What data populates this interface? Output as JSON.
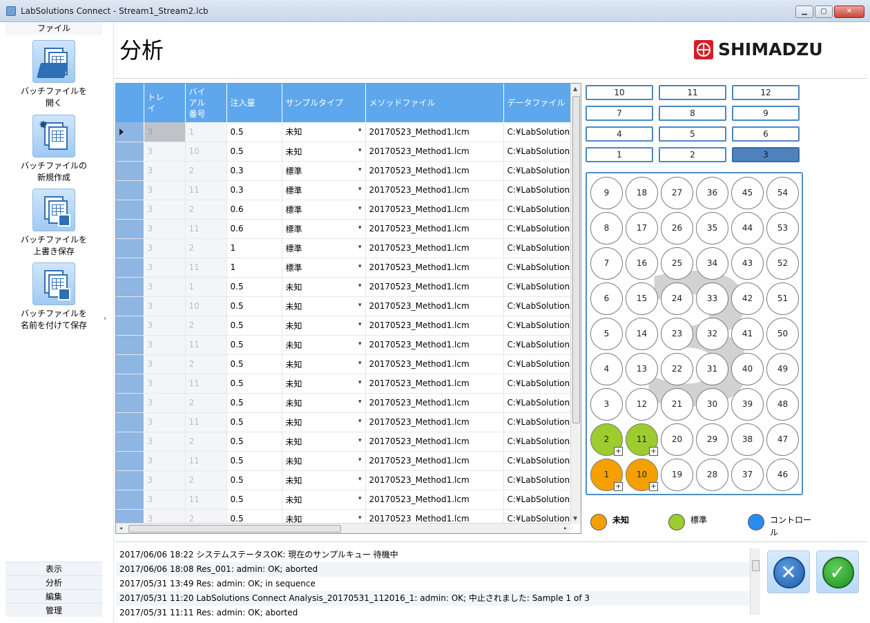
{
  "window": {
    "title": "LabSolutions Connect - Stream1_Stream2.lcb",
    "min_label": "▁",
    "max_label": "▢",
    "close_label": "✕"
  },
  "sidebar": {
    "header": "ファイル",
    "items": [
      {
        "label": "バッチファイルを\n開く",
        "icon": "open-batch-file-icon"
      },
      {
        "label": "バッチファイルの\n新規作成",
        "icon": "new-batch-file-icon"
      },
      {
        "label": "バッチファイルを\n上書き保存",
        "icon": "save-batch-file-icon"
      },
      {
        "label": "バッチファイルを\n名前を付けて保存",
        "icon": "save-as-batch-file-icon"
      }
    ],
    "collapse_glyph": "‹",
    "nav": [
      "表示",
      "分析",
      "編集",
      "管理"
    ]
  },
  "header": {
    "title": "分析",
    "logo_text": "SHIMADZU"
  },
  "table": {
    "columns": [
      "",
      "トレ\nイ",
      "バイ\nアル\n番号",
      "注入量",
      "サンプルタイプ",
      "メソッドファイル",
      "データファイル"
    ],
    "rows": [
      [
        "3",
        "1",
        "0.5",
        "未知",
        "20170523_Method1.lcm",
        "C:¥LabSolutions"
      ],
      [
        "3",
        "10",
        "0.5",
        "未知",
        "20170523_Method1.lcm",
        "C:¥LabSolutions"
      ],
      [
        "3",
        "2",
        "0.3",
        "標準",
        "20170523_Method1.lcm",
        "C:¥LabSolutions"
      ],
      [
        "3",
        "11",
        "0.3",
        "標準",
        "20170523_Method1.lcm",
        "C:¥LabSolutions"
      ],
      [
        "3",
        "2",
        "0.6",
        "標準",
        "20170523_Method1.lcm",
        "C:¥LabSolutions"
      ],
      [
        "3",
        "11",
        "0.6",
        "標準",
        "20170523_Method1.lcm",
        "C:¥LabSolutions"
      ],
      [
        "3",
        "2",
        "1",
        "標準",
        "20170523_Method1.lcm",
        "C:¥LabSolutions"
      ],
      [
        "3",
        "11",
        "1",
        "標準",
        "20170523_Method1.lcm",
        "C:¥LabSolutions"
      ],
      [
        "3",
        "1",
        "0.5",
        "未知",
        "20170523_Method1.lcm",
        "C:¥LabSolutions"
      ],
      [
        "3",
        "10",
        "0.5",
        "未知",
        "20170523_Method1.lcm",
        "C:¥LabSolutions"
      ],
      [
        "3",
        "2",
        "0.5",
        "未知",
        "20170523_Method1.lcm",
        "C:¥LabSolutions"
      ],
      [
        "3",
        "11",
        "0.5",
        "未知",
        "20170523_Method1.lcm",
        "C:¥LabSolutions"
      ],
      [
        "3",
        "2",
        "0.5",
        "未知",
        "20170523_Method1.lcm",
        "C:¥LabSolutions"
      ],
      [
        "3",
        "11",
        "0.5",
        "未知",
        "20170523_Method1.lcm",
        "C:¥LabSolutions"
      ],
      [
        "3",
        "2",
        "0.5",
        "未知",
        "20170523_Method1.lcm",
        "C:¥LabSolutions"
      ],
      [
        "3",
        "11",
        "0.5",
        "未知",
        "20170523_Method1.lcm",
        "C:¥LabSolutions"
      ],
      [
        "3",
        "2",
        "0.5",
        "未知",
        "20170523_Method1.lcm",
        "C:¥LabSolutions"
      ],
      [
        "3",
        "11",
        "0.5",
        "未知",
        "20170523_Method1.lcm",
        "C:¥LabSolutions"
      ],
      [
        "3",
        "2",
        "0.5",
        "未知",
        "20170523_Method1.lcm",
        "C:¥LabSolutions"
      ],
      [
        "3",
        "11",
        "0.5",
        "未知",
        "20170523_Method1.lcm",
        "C:¥LabSolutions"
      ],
      [
        "3",
        "2",
        "0.5",
        "未知",
        "20170523_Method1.lcm",
        "C:¥LabSolutions"
      ]
    ],
    "dropdown_glyph": "▾",
    "scroll_glyphs": {
      "up": "▲",
      "down": "▼",
      "left": "◂",
      "right": "▸",
      "grip": "Ⅲ"
    }
  },
  "trays": {
    "buttons": [
      [
        "10",
        "11",
        "12"
      ],
      [
        "7",
        "8",
        "9"
      ],
      [
        "4",
        "5",
        "6"
      ],
      [
        "1",
        "2",
        "3"
      ]
    ],
    "selected": "3"
  },
  "vials": {
    "watermark": "3",
    "columns": [
      [
        "9",
        "8",
        "7",
        "6",
        "5",
        "4",
        "3",
        "2",
        "1"
      ],
      [
        "18",
        "17",
        "16",
        "15",
        "14",
        "13",
        "12",
        "11",
        "10"
      ],
      [
        "27",
        "26",
        "25",
        "24",
        "23",
        "22",
        "21",
        "20",
        "19"
      ],
      [
        "36",
        "35",
        "34",
        "33",
        "32",
        "31",
        "30",
        "29",
        "28"
      ],
      [
        "45",
        "44",
        "43",
        "42",
        "41",
        "40",
        "39",
        "38",
        "37"
      ],
      [
        "54",
        "53",
        "52",
        "51",
        "50",
        "49",
        "48",
        "47",
        "46"
      ]
    ],
    "unknown": [
      "1",
      "10"
    ],
    "standard": [
      "2",
      "11"
    ],
    "plus_glyph": "+"
  },
  "legend": [
    {
      "label": "未知",
      "color": "#f5a000"
    },
    {
      "label": "標準",
      "color": "#9ccc2e"
    },
    {
      "label": "コントロー\nル",
      "color": "#2a8cf0"
    }
  ],
  "log": [
    "2017/06/06 18:22 システムステータスOK: 現在のサンプルキュー 待機中",
    "2017/06/06 18:08 Res_001: admin: OK; aborted",
    "2017/05/31 13:49 Res: admin: OK; in sequence",
    "2017/05/31 11:20 LabSolutions Connect Analysis_20170531_112016_1: admin: OK; 中止されました: Sample 1 of 3",
    "2017/05/31 11:11 Res: admin: OK; aborted"
  ],
  "actions": {
    "cancel_glyph": "✕",
    "ok_glyph": "✓"
  },
  "colors": {
    "header_blue": "#5ea7ec",
    "unknown": "#f5a000",
    "standard": "#9ccc2e",
    "control": "#2a8cf0",
    "tray_active": "#4f81bd"
  }
}
